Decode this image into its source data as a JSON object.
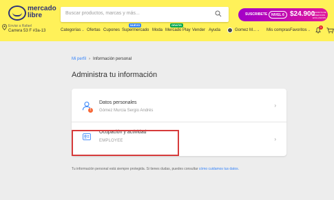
{
  "header": {
    "logo": {
      "text": "mercado libre"
    },
    "search": {
      "placeholder": "Buscar productos, marcas y más..."
    },
    "promo": {
      "text": "SUSCRIBETE",
      "badge": "NIVEL 6",
      "price": "$24.900",
      "note": "DISFRUTA DE BENEFICIOS EXCLUSIVOS"
    },
    "location": {
      "line1": "Enviar a Rafael",
      "line2": "Carrera 53 F #3a-13"
    },
    "nav": [
      {
        "label": "Categorías"
      },
      {
        "label": "Ofertas"
      },
      {
        "label": "Cupones"
      },
      {
        "label": "Supermercado",
        "badge": "NUEVO"
      },
      {
        "label": "Moda"
      },
      {
        "label": "Mercado Play",
        "badge": "GRATIS"
      },
      {
        "label": "Vender"
      },
      {
        "label": "Ayuda"
      }
    ],
    "user": {
      "label": "Gomez M..."
    },
    "my_purchases": "Mis compras",
    "favorites": "Favoritos",
    "notifications_count": "1",
    "colors": {
      "header_bg": "#fff159",
      "brand": "#2d3277",
      "link": "#3483fa",
      "highlight": "#d63a3a"
    }
  },
  "breadcrumb": {
    "root": "Mi perfil",
    "current": "Información personal"
  },
  "page_title": "Administra tu información",
  "rows": [
    {
      "label": "Datos personales",
      "sub": "Gómez Murcia Sergio Andrés",
      "icon": "person-icon",
      "alert": "!"
    },
    {
      "label": "Ocupación y actividad",
      "sub": "EMPLOYEE",
      "icon": "id-card-icon"
    }
  ],
  "footer": {
    "text": "Tu información personal está siempre protegida. Si tienes dudas, puedes consultar",
    "link": "cómo cuidamos tus datos."
  }
}
